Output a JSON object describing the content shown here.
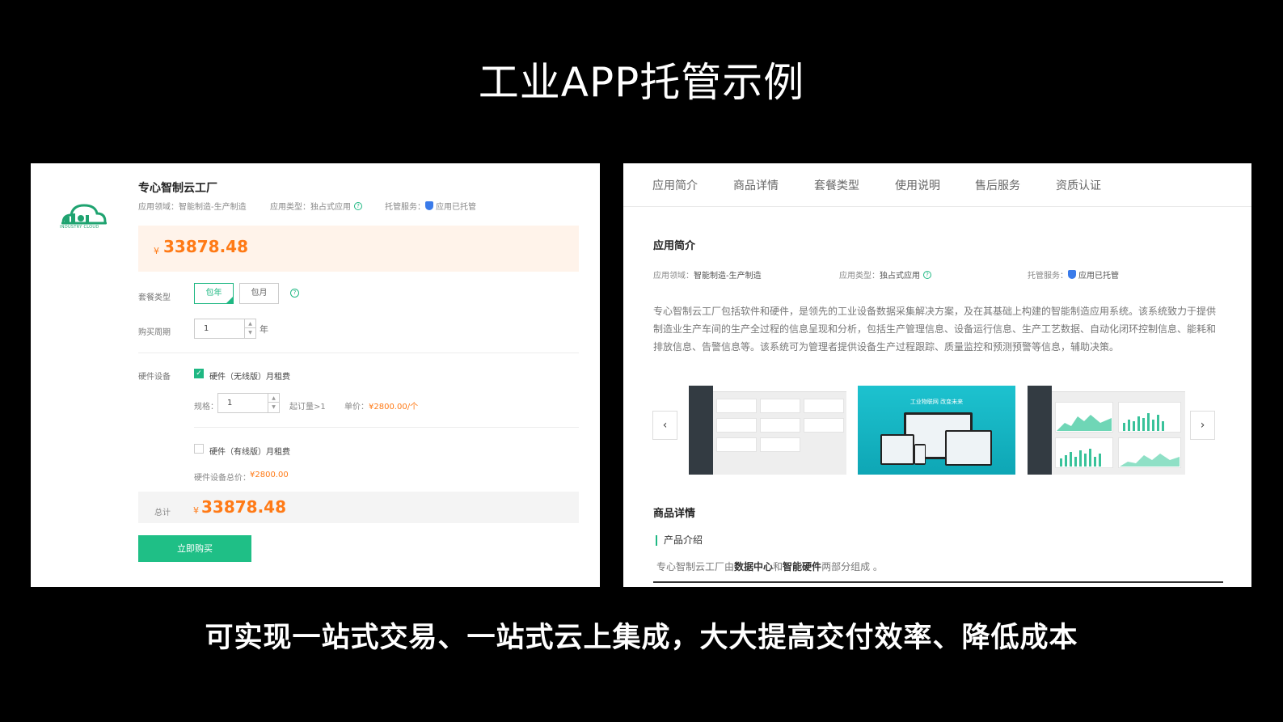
{
  "slide": {
    "title": "工业APP托管示例",
    "caption": "可实现一站式交易、一站式云上集成，大大提高交付效率、降低成本"
  },
  "purchase": {
    "logo_text": "INDUSTRY CLOUD",
    "product_name": "专心智制云工厂",
    "meta": {
      "domain_label": "应用领域：",
      "domain_value": "智能制造-生产制造",
      "type_label": "应用类型：",
      "type_value": "独占式应用",
      "service_label": "托管服务：",
      "service_value": "应用已托管"
    },
    "currency": "¥",
    "price": "33878.48",
    "plan_label": "套餐类型",
    "plan_options": [
      "包年",
      "包月"
    ],
    "plan_selected": "包年",
    "period_label": "购买周期",
    "period_value": "1",
    "period_unit": "年",
    "hardware_label": "硬件设备",
    "hardware_wireless": {
      "label": "硬件（无线版）月租费",
      "checked": true,
      "spec_label": "规格：",
      "spec_value": "1",
      "min_order": "起订量>1",
      "unit_price_label": "单价：",
      "unit_price": "¥2800.00/个"
    },
    "hardware_wired": {
      "label": "硬件（有线版）月租费",
      "checked": false
    },
    "hardware_total_label": "硬件设备总价：",
    "hardware_total": "¥2800.00",
    "total_label": "总计",
    "total_price": "33878.48",
    "buy_button": "立即购买"
  },
  "detail": {
    "tabs": [
      "应用简介",
      "商品详情",
      "套餐类型",
      "使用说明",
      "售后服务",
      "资质认证"
    ],
    "intro_title": "应用简介",
    "meta": {
      "domain_label": "应用领域：",
      "domain_value": "智能制造-生产制造",
      "type_label": "应用类型：",
      "type_value": "独占式应用",
      "service_label": "托管服务：",
      "service_value": "应用已托管"
    },
    "description": "专心智制云工厂包括软件和硬件，是领先的工业设备数据采集解决方案，及在其基础上构建的智能制造应用系统。该系统致力于提供制造业生产车间的生产全过程的信息呈现和分析，包括生产管理信息、设备运行信息、生产工艺数据、自动化闭环控制信息、能耗和排放信息、告警信息等。该系统可为管理者提供设备生产过程跟踪、质量监控和预测预警等信息，辅助决策。",
    "carousel_prev": "‹",
    "carousel_next": "›",
    "banner_slogan": "工业物联网   改变未来",
    "goods_title": "商品详情",
    "sub_title": "产品介绍",
    "intro_prefix": "专心智制云工厂由",
    "intro_hl1": "数据中心",
    "intro_mid": "和",
    "intro_hl2": "智能硬件",
    "intro_suffix": "两部分组成 。"
  },
  "colors": {
    "brand_green": "#1fbf86",
    "price_orange": "#ff7a16",
    "shield_blue": "#3a7bea"
  }
}
